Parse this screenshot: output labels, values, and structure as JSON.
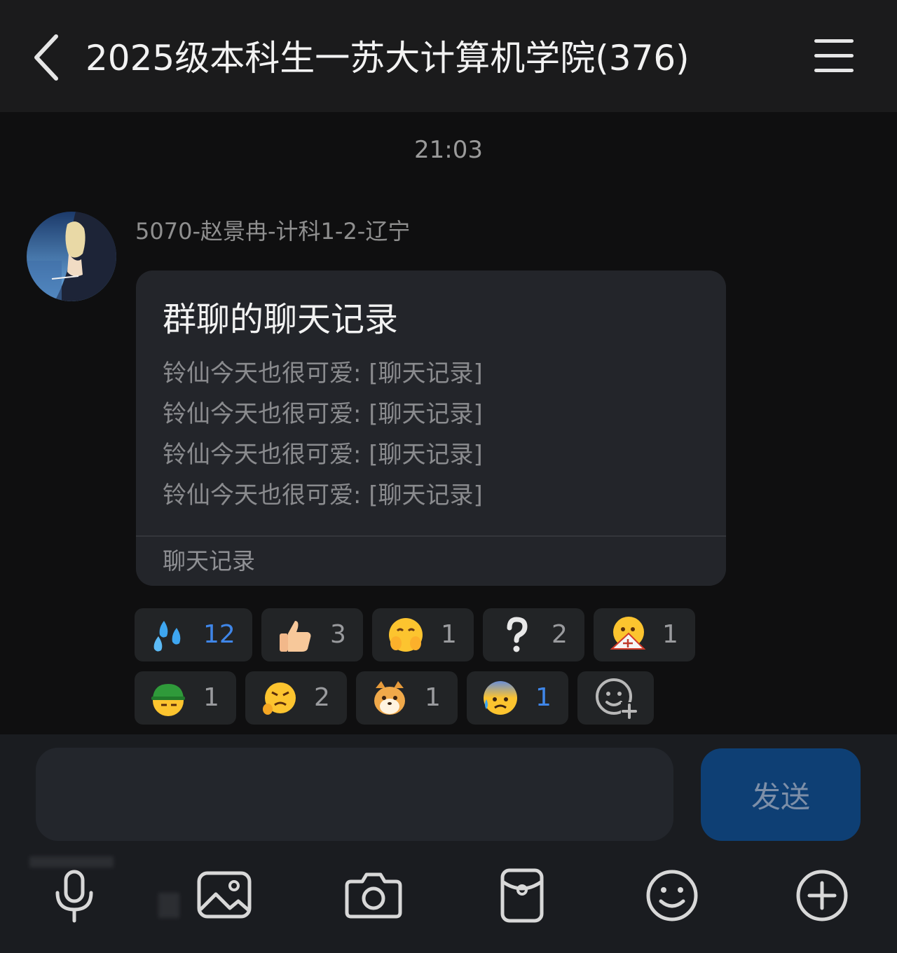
{
  "header": {
    "title": "2025级本科生一苏大计算机学院(376)"
  },
  "chat": {
    "timestamp": "21:03",
    "message": {
      "sender": "5070-赵景冉-计科1-2-辽宁",
      "card": {
        "title": "群聊的聊天记录",
        "lines": [
          "铃仙今天也很可爱: [聊天记录]",
          "铃仙今天也很可爱: [聊天记录]",
          "铃仙今天也很可爱: [聊天记录]",
          "铃仙今天也很可爱: [聊天记录]"
        ],
        "footer": "聊天记录"
      }
    },
    "reactions": [
      {
        "icon": "sweat-drops-icon",
        "count": "12",
        "highlighted": true
      },
      {
        "icon": "thumbs-up-icon",
        "count": "3",
        "highlighted": false
      },
      {
        "icon": "hands-covering-face-icon",
        "count": "1",
        "highlighted": false
      },
      {
        "icon": "question-mark-icon",
        "count": "2",
        "highlighted": false
      },
      {
        "icon": "fan-face-icon",
        "count": "1",
        "highlighted": false
      },
      {
        "icon": "green-hat-face-icon",
        "count": "1",
        "highlighted": false
      },
      {
        "icon": "angry-face-icon",
        "count": "2",
        "highlighted": false
      },
      {
        "icon": "shiba-dog-icon",
        "count": "1",
        "highlighted": false
      },
      {
        "icon": "anxious-sweat-face-icon",
        "count": "1",
        "highlighted": true
      }
    ]
  },
  "composer": {
    "placeholder": "",
    "send_label": "发送"
  },
  "toolbar": [
    {
      "icon": "microphone-icon"
    },
    {
      "icon": "image-icon"
    },
    {
      "icon": "camera-icon"
    },
    {
      "icon": "red-packet-icon"
    },
    {
      "icon": "emoji-icon"
    },
    {
      "icon": "plus-icon"
    }
  ],
  "colors": {
    "background": "#0f0f10",
    "header": "#1b1b1c",
    "card": "#23252a",
    "send_button": "#0e3f74",
    "highlight_count": "#3f86e8"
  }
}
